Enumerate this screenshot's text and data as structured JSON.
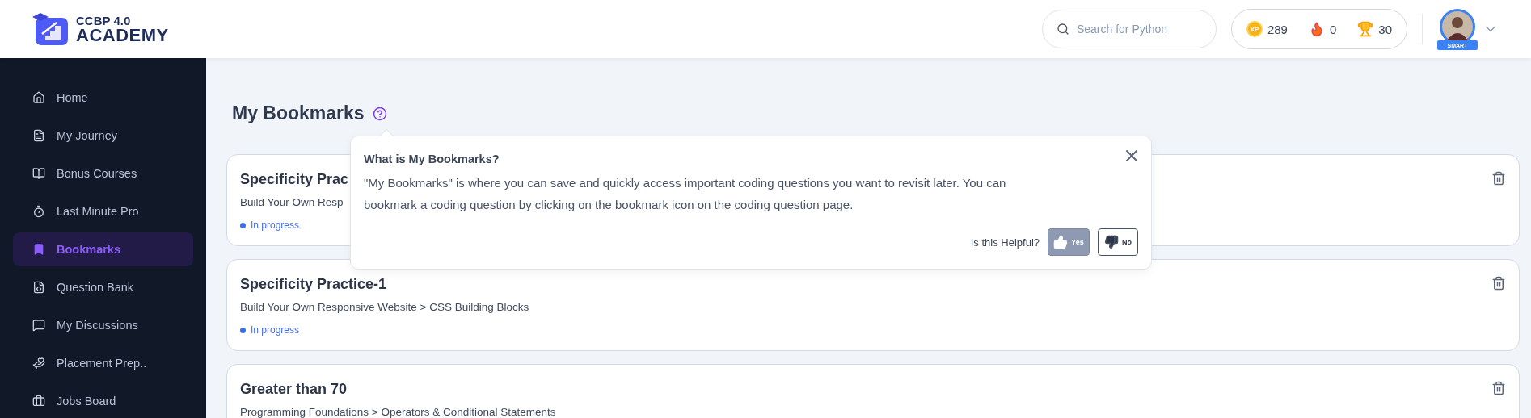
{
  "header": {
    "logo": {
      "line1": "CCBP 4.0",
      "line2": "ACADEMY"
    },
    "search": {
      "placeholder": "Search for Python"
    },
    "stats": [
      {
        "kind": "xp",
        "badge": "XP",
        "value": "289"
      },
      {
        "kind": "streak",
        "value": "0"
      },
      {
        "kind": "trophy",
        "value": "30"
      }
    ],
    "profile": {
      "ribbon": "SMART"
    }
  },
  "sidebar": {
    "items": [
      {
        "label": "Home",
        "kind": "home",
        "selected": false
      },
      {
        "label": "My Journey",
        "kind": "journey",
        "selected": false
      },
      {
        "label": "Bonus Courses",
        "kind": "book",
        "selected": false
      },
      {
        "label": "Last Minute Pro",
        "kind": "timer",
        "selected": false
      },
      {
        "label": "Bookmarks",
        "kind": "bookmark",
        "selected": true
      },
      {
        "label": "Question Bank",
        "kind": "code",
        "selected": false
      },
      {
        "label": "My Discussions",
        "kind": "chat",
        "selected": false
      },
      {
        "label": "Placement Prep..",
        "kind": "placement",
        "selected": false
      },
      {
        "label": "Jobs Board",
        "kind": "briefcase",
        "selected": false
      }
    ]
  },
  "page": {
    "title": "My Bookmarks"
  },
  "help": {
    "title": "What is My Bookmarks?",
    "body": "\"My Bookmarks\" is where you can save and quickly access important coding questions you want to revisit later. You can bookmark a coding question by clicking on the bookmark icon on the coding question page.",
    "prompt": "Is this Helpful?",
    "buttons": [
      {
        "kind": "yes",
        "label": "Yes",
        "selected": true
      },
      {
        "kind": "no",
        "label": "No",
        "selected": false
      }
    ]
  },
  "bookmarks": [
    {
      "title": "Specificity Prac",
      "path": "Build Your Own Resp",
      "status": "In progress"
    },
    {
      "title": "Specificity Practice-1",
      "path": "Build Your Own Responsive Website > CSS Building Blocks",
      "status": "In progress"
    },
    {
      "title": "Greater than 70",
      "path": "Programming Foundations > Operators & Conditional Statements"
    }
  ]
}
